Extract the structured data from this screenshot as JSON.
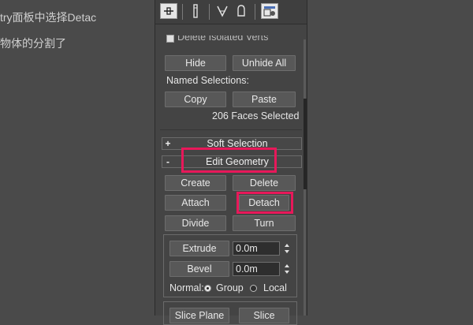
{
  "background": {
    "line1": "try面板中选择Detac",
    "line2": "物体的分割了"
  },
  "edit_selection": {
    "delete_isolated_verts": "Delete Isolated Verts",
    "hide_label": "Hide",
    "unhide_all_label": "Unhide All",
    "named_selections_label": "Named Selections:",
    "copy_label": "Copy",
    "paste_label": "Paste",
    "status": "206 Faces Selected"
  },
  "rollouts": {
    "soft_selection": {
      "sign": "+",
      "title": "Soft Selection"
    },
    "edit_geometry": {
      "sign": "-",
      "title": "Edit Geometry"
    }
  },
  "edit_geometry": {
    "create_label": "Create",
    "delete_label": "Delete",
    "attach_label": "Attach",
    "detach_label": "Detach",
    "divide_label": "Divide",
    "turn_label": "Turn",
    "extrude_label": "Extrude",
    "extrude_value": "0.0m",
    "bevel_label": "Bevel",
    "bevel_value": "0.0m",
    "normal_label": "Normal:",
    "group_label": "Group",
    "local_label": "Local",
    "slice_plane_label": "Slice Plane",
    "slice_label": "Slice"
  },
  "colors": {
    "highlight": "#e8185a",
    "panel_bg": "#444444"
  }
}
